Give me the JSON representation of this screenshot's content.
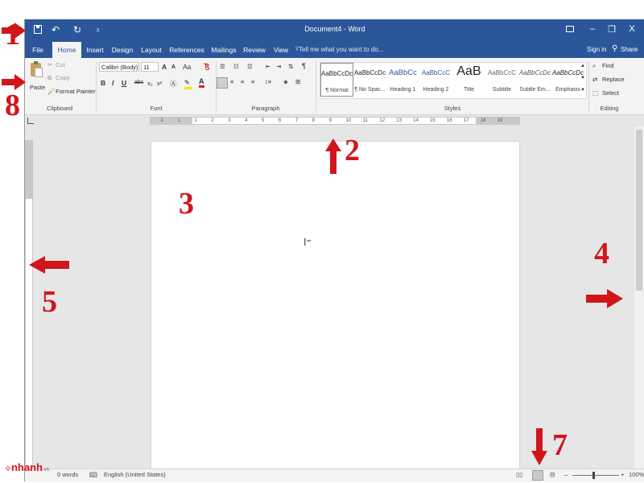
{
  "titlebar": {
    "document_title": "Document4 - Word",
    "undo": "↶",
    "redo": "↻",
    "customize": "⩡",
    "minimize": "–",
    "restore": "❐",
    "close": "X"
  },
  "tabs": [
    "File",
    "Home",
    "Insert",
    "Design",
    "Layout",
    "References",
    "Mailings",
    "Review",
    "View"
  ],
  "tell_me": "Tell me what you want to do...",
  "sign_in": "Sign in",
  "share": "Share",
  "clipboard": {
    "paste": "Paste",
    "cut": "Cut",
    "copy": "Copy",
    "format_painter": "Format Painter",
    "label": "Clipboard"
  },
  "font": {
    "name": "Calibri (Body)",
    "size": "11",
    "grow": "A",
    "shrink": "A",
    "case": "Aa",
    "bold": "B",
    "italic": "I",
    "underline": "U",
    "strike": "abc",
    "sub": "x₂",
    "sup": "x²",
    "label": "Font"
  },
  "paragraph": {
    "label": "Paragraph",
    "pilcrow": "¶"
  },
  "styles": {
    "label": "Styles",
    "items": [
      {
        "preview": "AaBbCcDc",
        "name": "¶ Normal"
      },
      {
        "preview": "AaBbCcDc",
        "name": "¶ No Spac..."
      },
      {
        "preview": "AaBbCc",
        "name": "Heading 1"
      },
      {
        "preview": "AaBbCcC",
        "name": "Heading 2"
      },
      {
        "preview": "AaB",
        "name": "Title"
      },
      {
        "preview": "AaBbCcC",
        "name": "Subtitle"
      },
      {
        "preview": "AaBbCcDc",
        "name": "Subtle Em..."
      },
      {
        "preview": "AaBbCcDc",
        "name": "Emphasis"
      }
    ]
  },
  "editing": {
    "find": "Find",
    "replace": "Replace",
    "select": "Select",
    "label": "Editing"
  },
  "ruler": {
    "numbers": [
      "2",
      "1",
      "1",
      "2",
      "3",
      "4",
      "5",
      "6",
      "7",
      "8",
      "9",
      "10",
      "11",
      "12",
      "13",
      "14",
      "15",
      "16",
      "17",
      "18",
      "19"
    ]
  },
  "status": {
    "words": "0 words",
    "language": "English (United States)",
    "zoom_minus": "–",
    "zoom_plus": "+",
    "zoom": "100%"
  },
  "annotations": {
    "n1": "1",
    "n2": "2",
    "n3": "3",
    "n4": "4",
    "n5": "5",
    "n7": "7",
    "n8": "8"
  },
  "logo": {
    "text": "nhanh",
    "suffix": ".vn"
  },
  "colors": {
    "word_blue": "#2b579a",
    "annotation_red": "#d0161b"
  }
}
